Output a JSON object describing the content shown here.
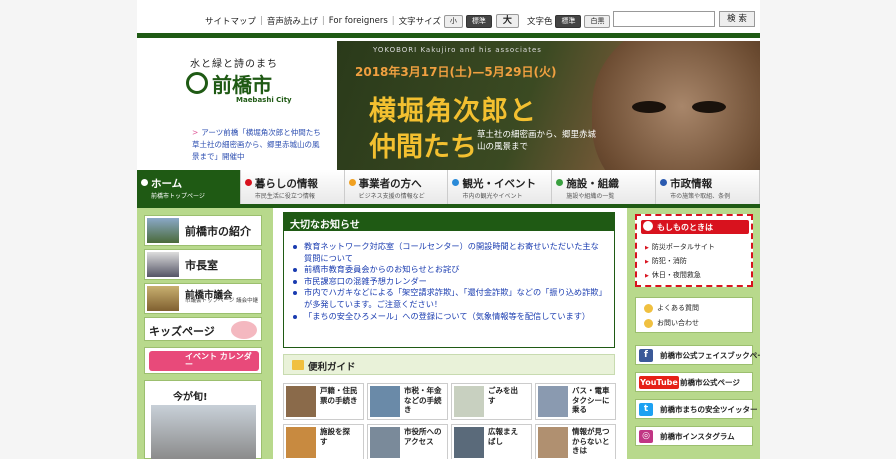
{
  "utility": {
    "sitemap": "サイトマップ",
    "read_aloud": "音声読み上げ",
    "foreigners": "For foreigners",
    "font_size_label": "文字サイズ",
    "font_small": "小",
    "font_standard": "標準",
    "font_large": "大",
    "color_label": "文字色",
    "color_standard": "標準",
    "color_bw": "白黒",
    "search_placeholder": "",
    "search_button": "検 索"
  },
  "logo": {
    "tagline": "水と緑と詩のまち",
    "name": "前橋市",
    "name_en": "Maebashi City"
  },
  "notice": {
    "text": "アーツ前橋「横堀角次郎と仲間たち　草土社の細密画から、郷里赤城山の風景まで」開催中"
  },
  "banner": {
    "subtitle": "YOKOBORI Kakujiro and his associates",
    "date": "2018年3月17日(土)—5月29日(火)",
    "title_line1": "横堀角次郎と",
    "title_line2": "仲間たち",
    "desc": "草土社の細密画から、郷里赤城山の風景まで"
  },
  "nav": [
    {
      "title": "ホーム",
      "sub": "前橋市トップページ",
      "color": "#ffffff"
    },
    {
      "title": "暮らしの情報",
      "sub": "市民生活に役立つ情報",
      "color": "#d8121e"
    },
    {
      "title": "事業者の方へ",
      "sub": "ビジネス支援の情報など",
      "color": "#f0a020"
    },
    {
      "title": "観光・イベント",
      "sub": "市内の観光やイベント",
      "color": "#2a8ad8"
    },
    {
      "title": "施設・組織",
      "sub": "施設や組織の一覧",
      "color": "#3aa040"
    },
    {
      "title": "市政情報",
      "sub": "市の施策や取組、条例",
      "color": "#2a5ab0"
    }
  ],
  "left": {
    "intro": "前橋市の紹介",
    "mayor": "市長室",
    "council_title": "前橋市議会",
    "council_sub": "市議会トップページ 議会中継",
    "kids": "キッズページ",
    "event": "イベント カレンダー",
    "kyou": "今が旬!"
  },
  "important": {
    "heading": "大切なお知らせ",
    "items": [
      "教育ネットワーク対応室（コールセンター）の開設時間とお寄せいただいた主な質問について",
      "前橋市教育委員会からのお知らせとお詫び",
      "市民課窓口の混雑予想カレンダー",
      "市内でハガキなどによる「架空請求詐欺」、「還付金詐欺」などの「振り込め詐欺」が多発しています。ご注意ください！",
      "「まちの安全ひろメール」への登録について（気象情報等を配信しています）"
    ]
  },
  "guide": {
    "heading": "便利ガイド",
    "tiles": [
      {
        "label": "戸籍・住民票の手続き",
        "color": "#8a6a4a"
      },
      {
        "label": "市税・年金などの手続き",
        "color": "#6a8aa8"
      },
      {
        "label": "ごみを出す",
        "color": "#c8d0c0"
      },
      {
        "label": "バス・電車タクシーに乗る",
        "color": "#8a9ab0"
      },
      {
        "label": "施設を探す",
        "color": "#c88a40"
      },
      {
        "label": "市役所へのアクセス",
        "color": "#7a8a9a"
      },
      {
        "label": "広報まえばし",
        "color": "#5a6a7a"
      },
      {
        "label": "情報が見つからないときは",
        "color": "#b09070"
      }
    ]
  },
  "emergency": {
    "heading": "もしものときは",
    "items": [
      "防災ポータルサイト",
      "防犯・消防",
      "休日・夜間救急"
    ]
  },
  "faq": {
    "items": [
      "よくある質問",
      "お問い合わせ"
    ]
  },
  "social": [
    {
      "label": "前橋市公式フェイスブックページ",
      "icon": "f",
      "color": "#3b5998"
    },
    {
      "label": "前橋市公式ページ",
      "icon": "YouTube",
      "color": "#e62117"
    },
    {
      "label": "前橋市まちの安全ツイッター",
      "icon": "t",
      "color": "#1da1f2"
    },
    {
      "label": "前橋市インスタグラム",
      "icon": "◎",
      "color": "#c13584"
    }
  ]
}
